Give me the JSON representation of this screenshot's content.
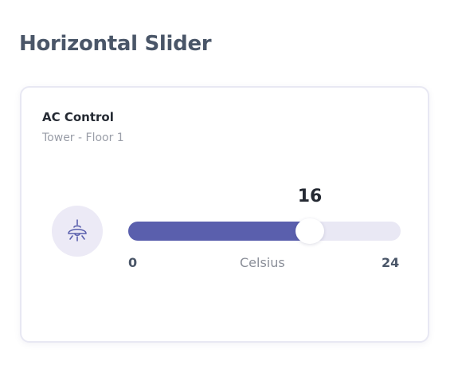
{
  "page": {
    "title": "Horizontal Slider"
  },
  "card": {
    "title": "AC Control",
    "subtitle": "Tower - Floor 1",
    "icon": "ceiling-lamp-icon",
    "slider": {
      "value": 16,
      "min": 0,
      "max": 24,
      "min_label": "0",
      "max_label": "24",
      "unit_label": "Celsius"
    }
  },
  "colors": {
    "accent": "#5a5fad",
    "track": "#e9e8f4",
    "icon_bg": "#eceaf6",
    "title": "#4a5668"
  }
}
